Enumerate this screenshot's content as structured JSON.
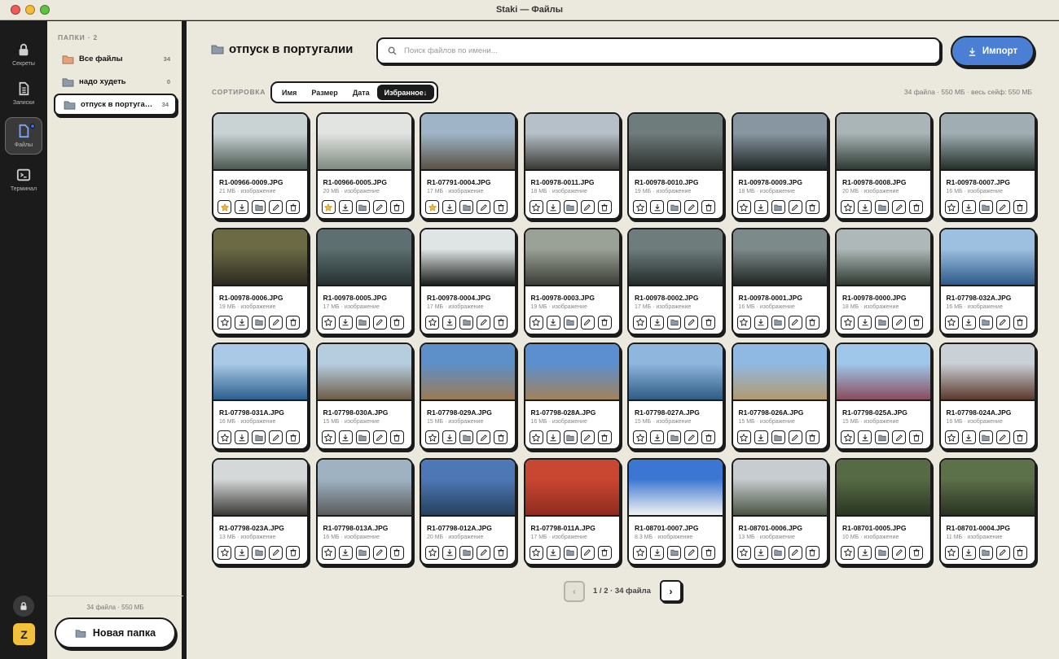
{
  "window": {
    "title": "Staki — Файлы"
  },
  "rail": [
    {
      "name": "secrets",
      "label": "Секреты",
      "icon": "lock-icon"
    },
    {
      "name": "notes",
      "label": "Записки",
      "icon": "document-icon"
    },
    {
      "name": "files",
      "label": "Файлы",
      "icon": "file-icon",
      "active": true
    },
    {
      "name": "terminal",
      "label": "Терминал",
      "icon": "terminal-icon"
    }
  ],
  "user": {
    "initial": "Z"
  },
  "sidebar": {
    "heading": "ПАПКИ · 2",
    "folders": [
      {
        "name": "Все файлы",
        "count": "34",
        "color": "#e9a17a"
      },
      {
        "name": "надо худеть",
        "count": "0",
        "color": "#8d9aa8"
      },
      {
        "name": "отпуск в португалии",
        "count": "34",
        "color": "#8d9aa8",
        "active": true
      }
    ],
    "stats": "34 файла · 550 МБ",
    "new_folder_label": "Новая папка"
  },
  "main": {
    "title": "отпуск в португалии",
    "search_placeholder": "Поиск файлов по имени...",
    "import_label": "Импорт",
    "sort_label": "СОРТИРОВКА",
    "sort_options": [
      "Имя",
      "Размер",
      "Дата",
      "Избранное↓"
    ],
    "sort_active": 3,
    "stats": "34 файла · 550 МБ · весь сейф: 550 МБ"
  },
  "files": [
    {
      "name": "R1-00966-0009.JPG",
      "meta": "21 МБ · изображение",
      "fav": true,
      "c1": "#c9d3d4",
      "c2": "#4c5a52"
    },
    {
      "name": "R1-00966-0005.JPG",
      "meta": "20 МБ · изображение",
      "fav": true,
      "c1": "#e2e4e1",
      "c2": "#7f8a80"
    },
    {
      "name": "R1-07791-0004.JPG",
      "meta": "17 МБ · изображение",
      "fav": true,
      "c1": "#9fb4c7",
      "c2": "#5a5245"
    },
    {
      "name": "R1-00978-0011.JPG",
      "meta": "18 МБ · изображение",
      "fav": false,
      "c1": "#b5c0c8",
      "c2": "#3a3935"
    },
    {
      "name": "R1-00978-0010.JPG",
      "meta": "19 МБ · изображение",
      "fav": false,
      "c1": "#6f7c7c",
      "c2": "#2b312e"
    },
    {
      "name": "R1-00978-0009.JPG",
      "meta": "18 МБ · изображение",
      "fav": false,
      "c1": "#8796a0",
      "c2": "#1f2726"
    },
    {
      "name": "R1-00978-0008.JPG",
      "meta": "20 МБ · изображение",
      "fav": false,
      "c1": "#a9b5b6",
      "c2": "#2e3a32"
    },
    {
      "name": "R1-00978-0007.JPG",
      "meta": "16 МБ · изображение",
      "fav": false,
      "c1": "#a0aeb4",
      "c2": "#243029"
    },
    {
      "name": "R1-00978-0006.JPG",
      "meta": "19 МБ · изображение",
      "fav": false,
      "c1": "#6b6a45",
      "c2": "#2d2a1f"
    },
    {
      "name": "R1-00978-0005.JPG",
      "meta": "17 МБ · изображение",
      "fav": false,
      "c1": "#5d6f70",
      "c2": "#263130"
    },
    {
      "name": "R1-00978-0004.JPG",
      "meta": "17 МБ · изображение",
      "fav": false,
      "c1": "#dfe4e4",
      "c2": "#1c211e"
    },
    {
      "name": "R1-00978-0003.JPG",
      "meta": "19 МБ · изображение",
      "fav": false,
      "c1": "#9aa196",
      "c2": "#3c3e37"
    },
    {
      "name": "R1-00978-0002.JPG",
      "meta": "17 МБ · изображение",
      "fav": false,
      "c1": "#6e7c7c",
      "c2": "#242c2a"
    },
    {
      "name": "R1-00978-0001.JPG",
      "meta": "16 МБ · изображение",
      "fav": false,
      "c1": "#7d8a8a",
      "c2": "#1f2623"
    },
    {
      "name": "R1-00978-0000.JPG",
      "meta": "18 МБ · изображение",
      "fav": false,
      "c1": "#aeb8b8",
      "c2": "#2f3a31"
    },
    {
      "name": "R1-07798-032A.JPG",
      "meta": "16 МБ · изображение",
      "fav": false,
      "c1": "#9ec0e0",
      "c2": "#2d5a8a"
    },
    {
      "name": "R1-07798-031A.JPG",
      "meta": "16 МБ · изображение",
      "fav": false,
      "c1": "#a9c9e6",
      "c2": "#2c5f8f"
    },
    {
      "name": "R1-07798-030A.JPG",
      "meta": "15 МБ · изображение",
      "fav": false,
      "c1": "#b6cde0",
      "c2": "#6e5d48"
    },
    {
      "name": "R1-07798-029A.JPG",
      "meta": "15 МБ · изображение",
      "fav": false,
      "c1": "#5d90c8",
      "c2": "#9b7a52"
    },
    {
      "name": "R1-07798-028A.JPG",
      "meta": "16 МБ · изображение",
      "fav": false,
      "c1": "#5b8fcf",
      "c2": "#a2825a"
    },
    {
      "name": "R1-07798-027A.JPG",
      "meta": "15 МБ · изображение",
      "fav": false,
      "c1": "#8fb6dd",
      "c2": "#2f5c85"
    },
    {
      "name": "R1-07798-026A.JPG",
      "meta": "15 МБ · изображение",
      "fav": false,
      "c1": "#8fb9e2",
      "c2": "#b39a70"
    },
    {
      "name": "R1-07798-025A.JPG",
      "meta": "15 МБ · изображение",
      "fav": false,
      "c1": "#9ec7ea",
      "c2": "#8a4c5e"
    },
    {
      "name": "R1-07798-024A.JPG",
      "meta": "16 МБ · изображение",
      "fav": false,
      "c1": "#c9d0d6",
      "c2": "#5c3a2c"
    },
    {
      "name": "R1-07798-023A.JPG",
      "meta": "13 МБ · изображение",
      "fav": false,
      "c1": "#d5d8d9",
      "c2": "#3b3a36"
    },
    {
      "name": "R1-07798-013A.JPG",
      "meta": "16 МБ · изображение",
      "fav": false,
      "c1": "#9fb2c2",
      "c2": "#5a5c5c"
    },
    {
      "name": "R1-07798-012A.JPG",
      "meta": "20 МБ · изображение",
      "fav": false,
      "c1": "#4d78b5",
      "c2": "#26405e"
    },
    {
      "name": "R1-07798-011A.JPG",
      "meta": "17 МБ · изображение",
      "fav": false,
      "c1": "#c94631",
      "c2": "#8f2b1f"
    },
    {
      "name": "R1-08701-0007.JPG",
      "meta": "8.3 МБ · изображение",
      "fav": false,
      "c1": "#3b77d2",
      "c2": "#f2f3f3"
    },
    {
      "name": "R1-08701-0006.JPG",
      "meta": "13 МБ · изображение",
      "fav": false,
      "c1": "#c6cccf",
      "c2": "#4b5544"
    },
    {
      "name": "R1-08701-0005.JPG",
      "meta": "10 МБ · изображение",
      "fav": false,
      "c1": "#566b45",
      "c2": "#2b3523"
    },
    {
      "name": "R1-08701-0004.JPG",
      "meta": "11 МБ · изображение",
      "fav": false,
      "c1": "#5c7049",
      "c2": "#2a3322"
    }
  ],
  "pagination": {
    "prev": "‹",
    "info": "1 / 2 · 34 файла",
    "next": "›"
  }
}
